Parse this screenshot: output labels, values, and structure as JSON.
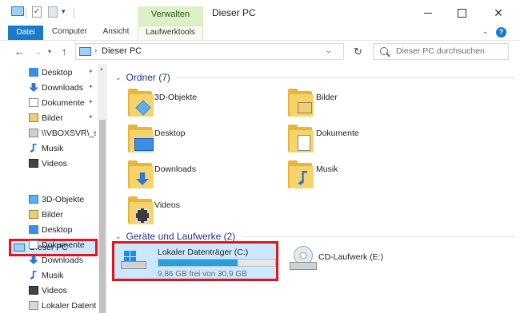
{
  "window": {
    "title": "Dieser PC",
    "context_tab_header": "Verwalten"
  },
  "ribbon": {
    "tabs": [
      "Datei",
      "Computer",
      "Ansicht",
      "Laufwerktools"
    ]
  },
  "address": {
    "path": "Dieser PC",
    "search_placeholder": "Dieser PC durchsuchen"
  },
  "sidebar": {
    "quick_access": [
      {
        "label": "Desktop",
        "icon": "desktop-icon",
        "pinned": true
      },
      {
        "label": "Downloads",
        "icon": "download-icon",
        "pinned": true
      },
      {
        "label": "Dokumente",
        "icon": "documents-icon",
        "pinned": true
      },
      {
        "label": "Bilder",
        "icon": "pictures-icon",
        "pinned": true
      },
      {
        "label": "\\\\VBOXSVR\\_sha",
        "icon": "network-share-icon",
        "pinned": false
      },
      {
        "label": "Musik",
        "icon": "music-icon",
        "pinned": false
      },
      {
        "label": "Videos",
        "icon": "videos-icon",
        "pinned": false
      }
    ],
    "this_pc": "Dieser PC",
    "this_pc_children": [
      {
        "label": "3D-Objekte",
        "icon": "3d-objects-icon"
      },
      {
        "label": "Bilder",
        "icon": "pictures-icon"
      },
      {
        "label": "Desktop",
        "icon": "desktop-icon"
      },
      {
        "label": "Dokumente",
        "icon": "documents-icon"
      },
      {
        "label": "Downloads",
        "icon": "download-icon"
      },
      {
        "label": "Musik",
        "icon": "music-icon"
      },
      {
        "label": "Videos",
        "icon": "videos-icon"
      },
      {
        "label": "Lokaler Datenträ",
        "icon": "drive-icon"
      }
    ]
  },
  "main": {
    "folders_header": "Ordner (7)",
    "folders": [
      {
        "label": "3D-Objekte",
        "icon": "3d-objects-icon"
      },
      {
        "label": "Bilder",
        "icon": "pictures-icon"
      },
      {
        "label": "Desktop",
        "icon": "desktop-icon"
      },
      {
        "label": "Dokumente",
        "icon": "documents-icon"
      },
      {
        "label": "Downloads",
        "icon": "download-icon"
      },
      {
        "label": "Musik",
        "icon": "music-icon"
      },
      {
        "label": "Videos",
        "icon": "videos-icon"
      }
    ],
    "devices_header": "Geräte und Laufwerke (2)",
    "drives": [
      {
        "label": "Lokaler Datenträger (C:)",
        "free_text": "9,86 GB frei von 30,9 GB",
        "used_fraction": 0.681,
        "selected": true
      },
      {
        "label": "CD-Laufwerk (E:)",
        "selected": false
      }
    ]
  },
  "colors": {
    "accent": "#1979ca",
    "highlight_border": "#e3141a",
    "selection": "#cce8ff",
    "context_tab": "#dcefc6",
    "drive_bar": "#26a0da"
  }
}
